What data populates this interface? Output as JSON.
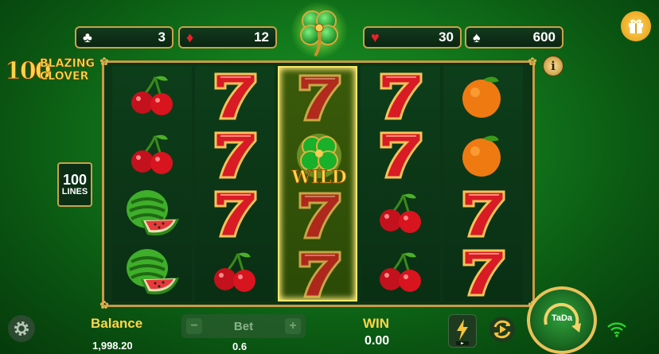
{
  "counters": [
    {
      "suit": "♣",
      "suit_name": "club-icon",
      "value": "3",
      "color": "#ffffff"
    },
    {
      "suit": "♦",
      "suit_name": "diamond-icon",
      "value": "12",
      "color": "#e8222a"
    },
    {
      "suit": "♥",
      "suit_name": "heart-icon",
      "value": "30",
      "color": "#e8222a"
    },
    {
      "suit": "♠",
      "suit_name": "spade-icon",
      "value": "600",
      "color": "#ffffff"
    }
  ],
  "logo": {
    "number": "100",
    "line1": "BLAZING",
    "line2": "CLOVER"
  },
  "lines_badge": {
    "number": "100",
    "label": "LINES"
  },
  "info_label": "i",
  "reels": [
    [
      "cherry",
      "cherry",
      "watermelon",
      "watermelon"
    ],
    [
      "seven",
      "seven",
      "seven",
      "cherry"
    ],
    [
      "seven",
      "clover-wild",
      "seven",
      "seven"
    ],
    [
      "seven",
      "seven",
      "cherry",
      "cherry"
    ],
    [
      "orange",
      "orange",
      "seven",
      "seven"
    ]
  ],
  "wild_label": "WILD",
  "bottom": {
    "balance_label": "Balance",
    "balance_value": "1,998.20",
    "bet_label": "Bet",
    "bet_minus": "−",
    "bet_plus": "+",
    "bet_value": "0.6",
    "win_label": "WIN",
    "win_value": "0.00",
    "spin_label": "TaDa"
  },
  "colors": {
    "gold": "#ffd54a",
    "frame": "#c99a45"
  }
}
